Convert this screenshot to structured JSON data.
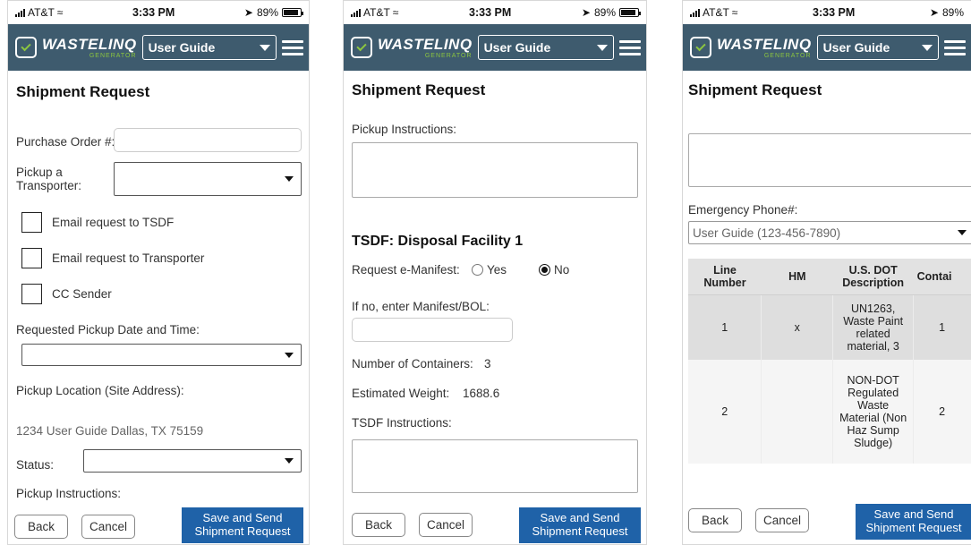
{
  "status_bar": {
    "carrier": "AT&T",
    "time": "3:33 PM",
    "battery": "89%",
    "battery_level": 0.89
  },
  "app_bar": {
    "brand": "WASTELINQ",
    "brand_sub": "GENERATOR",
    "selector_value": "User Guide"
  },
  "page_title": "Shipment Request",
  "screen1": {
    "purchase_order_label": "Purchase Order #:",
    "purchase_order_value": "",
    "transporter_label_line1": "Pickup a",
    "transporter_label_line2": "Transporter:",
    "transporter_value": "",
    "checkboxes": [
      {
        "label": "Email request to TSDF",
        "checked": false
      },
      {
        "label": "Email request to Transporter",
        "checked": false
      },
      {
        "label": "CC Sender",
        "checked": false
      }
    ],
    "pickup_date_label": "Requested Pickup Date and Time:",
    "pickup_location_label": "Pickup Location (Site Address):",
    "pickup_location_value": "1234 User Guide Dallas, TX 75159",
    "status_label": "Status:",
    "pickup_instructions_label": "Pickup Instructions:"
  },
  "screen2": {
    "pickup_instructions_label": "Pickup Instructions:",
    "tsdf_heading": "TSDF: Disposal Facility 1",
    "emanifest_label": "Request e-Manifest:",
    "emanifest_options": [
      "Yes",
      "No"
    ],
    "emanifest_selected": "No",
    "manifest_label": "If no, enter Manifest/BOL:",
    "containers_label": "Number of Containers:",
    "containers_value": "3",
    "weight_label": "Estimated Weight:",
    "weight_value": "1688.6",
    "tsdf_instructions_label": "TSDF Instructions:"
  },
  "screen3": {
    "emergency_phone_label": "Emergency Phone#:",
    "emergency_phone_value": "User Guide (123-456-7890)",
    "table_headers": [
      "Line Number",
      "HM",
      "U.S. DOT Description",
      "Contai"
    ],
    "table_rows": [
      {
        "line": "1",
        "hm": "x",
        "desc": "UN1263, Waste Paint related material, 3",
        "containers": "1"
      },
      {
        "line": "2",
        "hm": "",
        "desc": "NON-DOT Regulated Waste Material (Non Haz Sump Sludge)",
        "containers": "2"
      }
    ]
  },
  "buttons": {
    "back": "Back",
    "cancel": "Cancel",
    "save_send": "Save and Send Shipment Request"
  },
  "colors": {
    "app_bar": "#3e5b6e",
    "brand_green": "#8cc63f",
    "primary_button": "#1f62a8"
  },
  "icons": {
    "menu": "hamburger-icon",
    "signal": "signal-bars-icon",
    "wifi": "wifi-icon",
    "location": "location-arrow-icon",
    "battery": "battery-icon"
  }
}
